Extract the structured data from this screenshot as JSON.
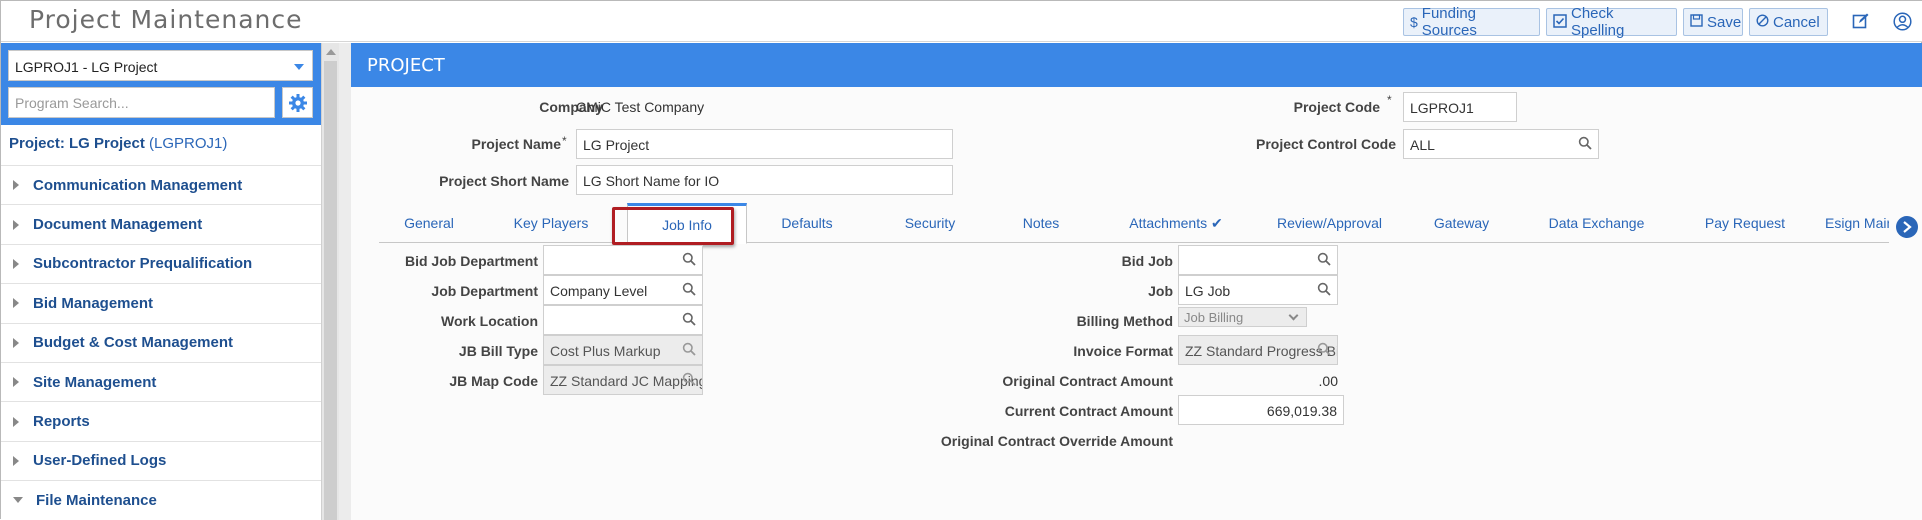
{
  "app": {
    "title": "Project Maintenance"
  },
  "toolbar": {
    "funding_sources": "Funding Sources",
    "check_spelling": "Check Spelling",
    "save": "Save",
    "cancel": "Cancel"
  },
  "sidebar": {
    "project_select": "LGPROJ1 - LG Project",
    "search_placeholder": "Program Search...",
    "project_label": "Project: LG Project",
    "project_code": "(LGPROJ1)",
    "items": [
      {
        "label": "Communication Management",
        "expanded": false
      },
      {
        "label": "Document Management",
        "expanded": false
      },
      {
        "label": "Subcontractor Prequalification",
        "expanded": false
      },
      {
        "label": "Bid Management",
        "expanded": false
      },
      {
        "label": "Budget & Cost Management",
        "expanded": false
      },
      {
        "label": "Site Management",
        "expanded": false
      },
      {
        "label": "Reports",
        "expanded": false
      },
      {
        "label": "User-Defined Logs",
        "expanded": false
      },
      {
        "label": "File Maintenance",
        "expanded": true
      }
    ]
  },
  "main": {
    "header": "PROJECT",
    "company_label": "Company",
    "company_value": "CMiC Test Company",
    "project_name_label": "Project Name",
    "project_name_value": "LG Project",
    "project_short_name_label": "Project Short Name",
    "project_short_name_value": "LG Short Name for IO",
    "project_code_label": "Project Code",
    "project_code_value": "LGPROJ1",
    "project_control_code_label": "Project Control Code",
    "project_control_code_value": "ALL",
    "required_mark": "*",
    "tabs": [
      {
        "label": "General"
      },
      {
        "label": "Key Players"
      },
      {
        "label": "Job Info",
        "active": true
      },
      {
        "label": "Defaults"
      },
      {
        "label": "Security"
      },
      {
        "label": "Notes"
      },
      {
        "label": "Attachments ✔"
      },
      {
        "label": "Review/Approval"
      },
      {
        "label": "Gateway"
      },
      {
        "label": "Data Exchange"
      },
      {
        "label": "Pay Request"
      },
      {
        "label": "Esign Main"
      }
    ],
    "job_info": {
      "bid_job_department_label": "Bid Job Department",
      "bid_job_department_value": "",
      "job_department_label": "Job Department",
      "job_department_value": "Company Level",
      "work_location_label": "Work Location",
      "work_location_value": "",
      "jb_bill_type_label": "JB Bill Type",
      "jb_bill_type_value": "Cost Plus Markup",
      "jb_map_code_label": "JB Map Code",
      "jb_map_code_value": "ZZ Standard JC Mapping",
      "bid_job_label": "Bid Job",
      "bid_job_value": "",
      "job_label": "Job",
      "job_value": "LG Job",
      "billing_method_label": "Billing Method",
      "billing_method_value": "Job Billing",
      "invoice_format_label": "Invoice Format",
      "invoice_format_value": "ZZ Standard Progress Billing",
      "original_contract_amount_label": "Original Contract Amount",
      "original_contract_amount_value": ".00",
      "current_contract_amount_label": "Current Contract Amount",
      "current_contract_amount_value": "669,019.38",
      "original_contract_override_amount_label": "Original Contract Override Amount"
    }
  },
  "colors": {
    "accent": "#3b87e6",
    "link": "#2a66b8",
    "highlight": "#b01d22"
  }
}
